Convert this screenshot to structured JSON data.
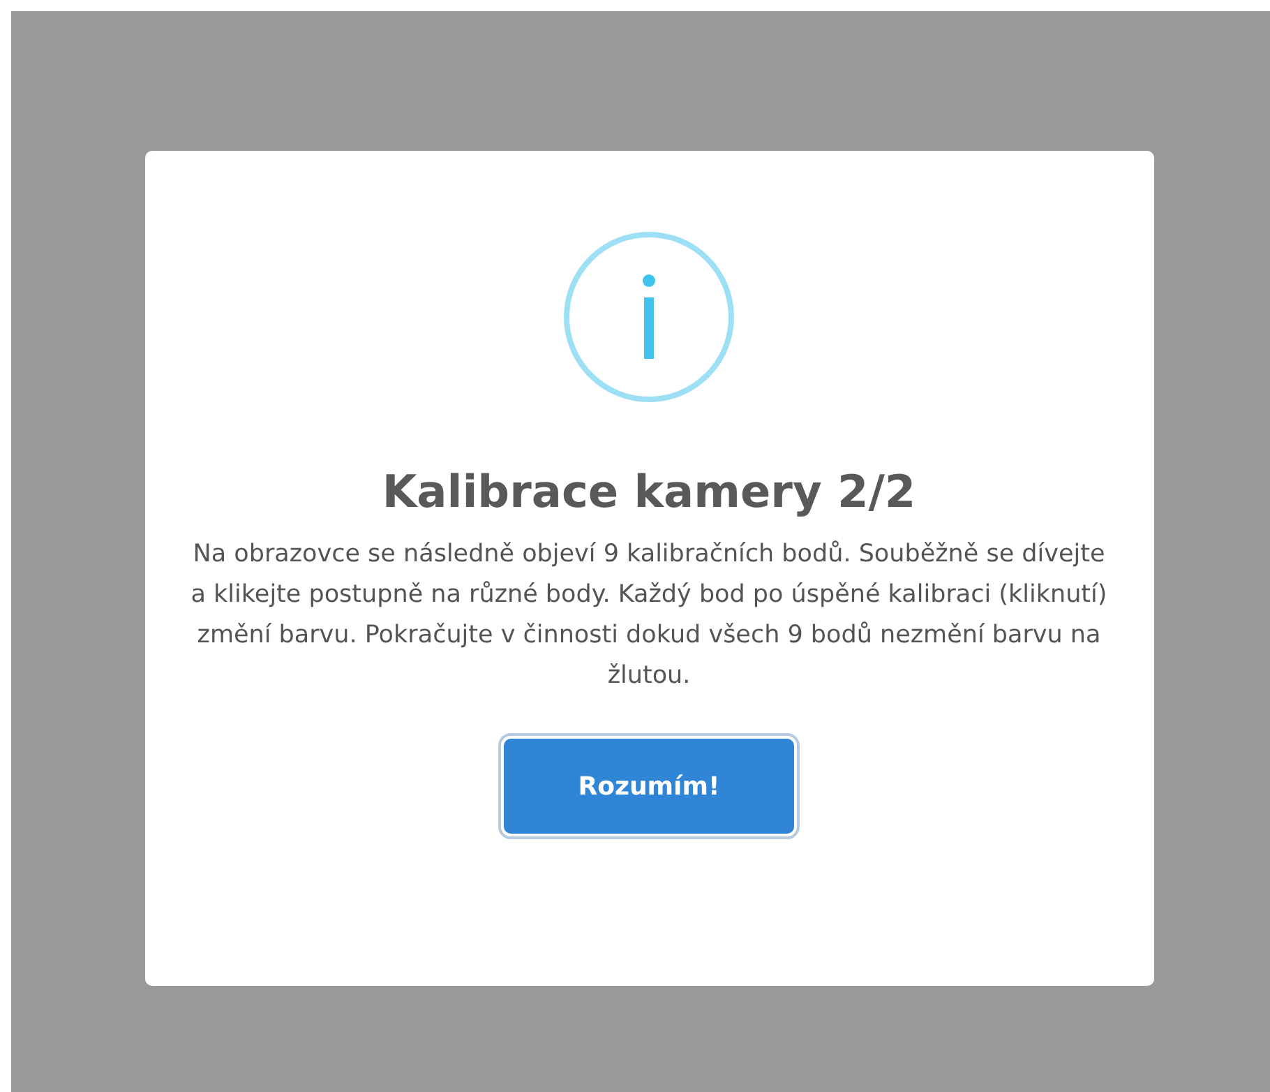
{
  "dialog": {
    "icon": {
      "kind": "info"
    },
    "title": "Kalibrace kamery 2/2",
    "message": "Na obrazovce se následně objeví 9 kalibračních bodů. Souběžně se dívejte a klikejte postupně na různé body. Každý bod po úspěné kalibraci (kliknutí) změní barvu. Pokračujte v činnosti dokud všech 9 bodů nezmění barvu na žlutou.",
    "confirm_button": "Rozumím!"
  }
}
